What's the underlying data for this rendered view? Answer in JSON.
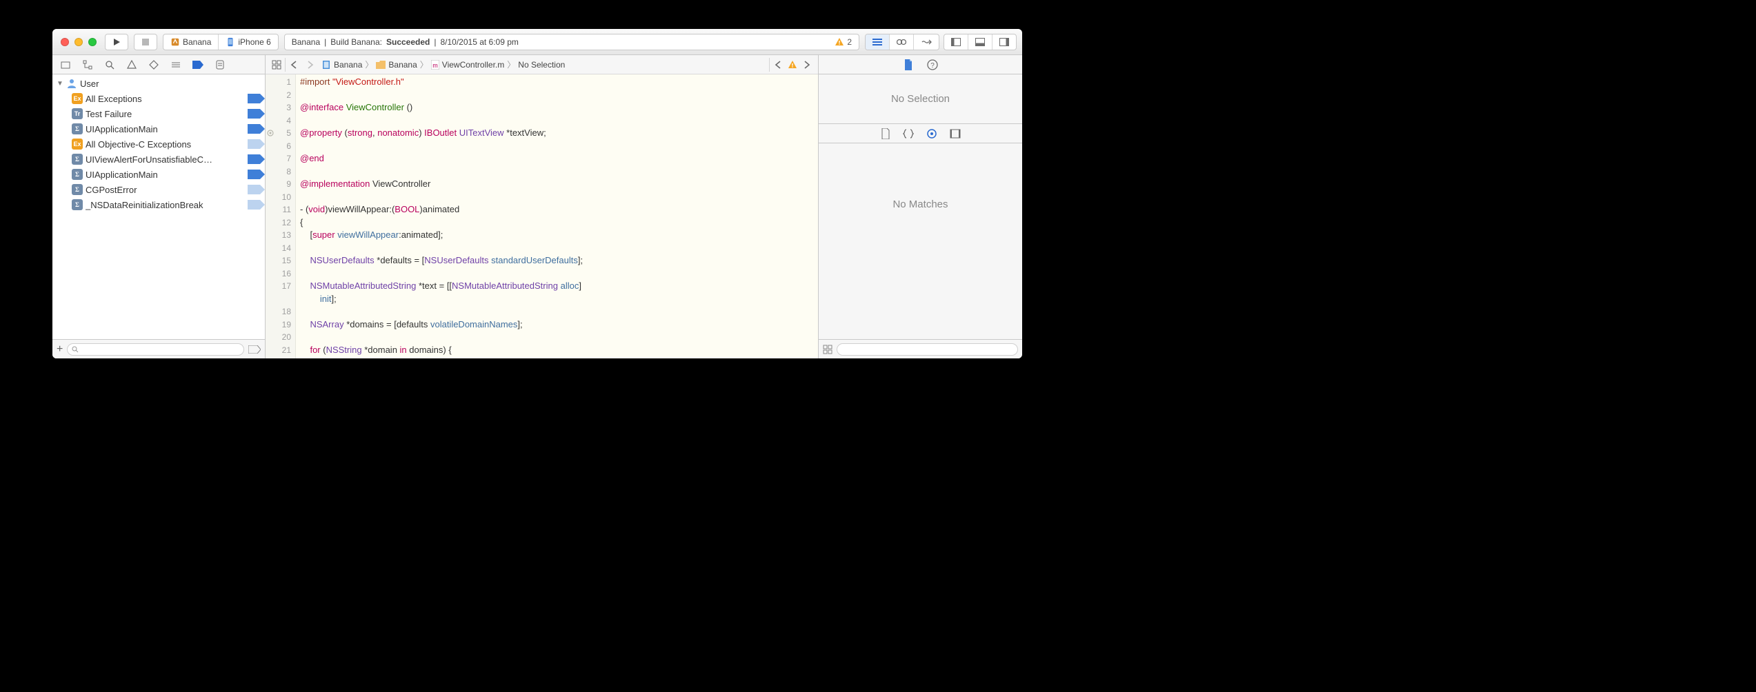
{
  "toolbar": {
    "scheme_app": "Banana",
    "scheme_device": "iPhone 6",
    "status_project": "Banana",
    "status_action": "Build Banana:",
    "status_result": "Succeeded",
    "status_time": "8/10/2015 at 6:09 pm",
    "status_sep": "|",
    "warning_count": "2"
  },
  "navigator": {
    "root": "User",
    "breakpoints": [
      {
        "kind": "Ex",
        "label": "All Exceptions",
        "enabled": true
      },
      {
        "kind": "Tr",
        "label": "Test Failure",
        "enabled": true
      },
      {
        "kind": "Σ",
        "label": "UIApplicationMain",
        "enabled": true
      },
      {
        "kind": "Ex",
        "label": "All Objective-C Exceptions",
        "enabled": false
      },
      {
        "kind": "Σ",
        "label": "UIViewAlertForUnsatisfiableC…",
        "enabled": true
      },
      {
        "kind": "Σ",
        "label": "UIApplicationMain",
        "enabled": true
      },
      {
        "kind": "Σ",
        "label": "CGPostError",
        "enabled": false
      },
      {
        "kind": "Σ",
        "label": "_NSDataReinitializationBreak",
        "enabled": false
      }
    ]
  },
  "jumpbar": {
    "c0": "Banana",
    "c1": "Banana",
    "c2": "ViewController.m",
    "c3": "No Selection"
  },
  "code": {
    "lines": [
      {
        "n": "1",
        "t": "#import \"ViewController.h\"",
        "cls": "l1"
      },
      {
        "n": "2",
        "t": "",
        "cls": ""
      },
      {
        "n": "3",
        "t": "@interface ViewController ()",
        "cls": "l3"
      },
      {
        "n": "4",
        "t": "",
        "cls": ""
      },
      {
        "n": "5",
        "t": "@property (strong, nonatomic) IBOutlet UITextView *textView;",
        "cls": "l5",
        "bp": true
      },
      {
        "n": "6",
        "t": "",
        "cls": ""
      },
      {
        "n": "7",
        "t": "@end",
        "cls": "l7"
      },
      {
        "n": "8",
        "t": "",
        "cls": ""
      },
      {
        "n": "9",
        "t": "@implementation ViewController",
        "cls": "l9"
      },
      {
        "n": "10",
        "t": "",
        "cls": ""
      },
      {
        "n": "11",
        "t": "- (void)viewWillAppear:(BOOL)animated",
        "cls": "l11"
      },
      {
        "n": "12",
        "t": "{",
        "cls": ""
      },
      {
        "n": "13",
        "t": "    [super viewWillAppear:animated];",
        "cls": "l13"
      },
      {
        "n": "14",
        "t": "",
        "cls": ""
      },
      {
        "n": "15",
        "t": "    NSUserDefaults *defaults = [NSUserDefaults standardUserDefaults];",
        "cls": "l15"
      },
      {
        "n": "16",
        "t": "",
        "cls": ""
      },
      {
        "n": "17",
        "t": "    NSMutableAttributedString *text = [[NSMutableAttributedString alloc]",
        "cls": "l17"
      },
      {
        "n": "",
        "t": "        init];",
        "cls": "l17b"
      },
      {
        "n": "18",
        "t": "",
        "cls": ""
      },
      {
        "n": "19",
        "t": "    NSArray *domains = [defaults volatileDomainNames];",
        "cls": "l19"
      },
      {
        "n": "20",
        "t": "",
        "cls": ""
      },
      {
        "n": "21",
        "t": "    for (NSString *domain in domains) {",
        "cls": "l21"
      }
    ]
  },
  "inspector": {
    "no_selection": "No Selection",
    "no_matches": "No Matches"
  }
}
